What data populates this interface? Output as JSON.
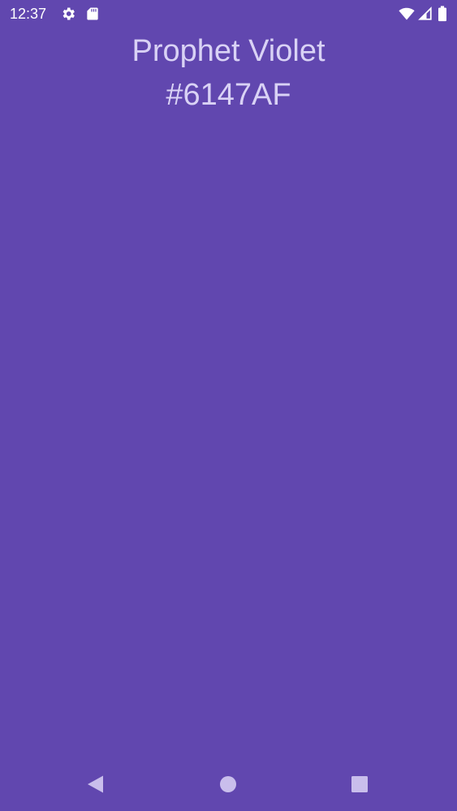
{
  "status_bar": {
    "time": "12:37",
    "icons": [
      "gear-icon",
      "sd-card-icon",
      "wifi-icon",
      "signal-icon",
      "battery-icon"
    ]
  },
  "color": {
    "name": "Prophet Violet",
    "hex": "#6147AF"
  },
  "theme": {
    "background": "#6147AF",
    "text": "#D9D2F5",
    "nav_icon": "#C9BEEC"
  },
  "nav_bar": {
    "buttons": [
      "back-icon",
      "home-icon",
      "recents-icon"
    ]
  }
}
